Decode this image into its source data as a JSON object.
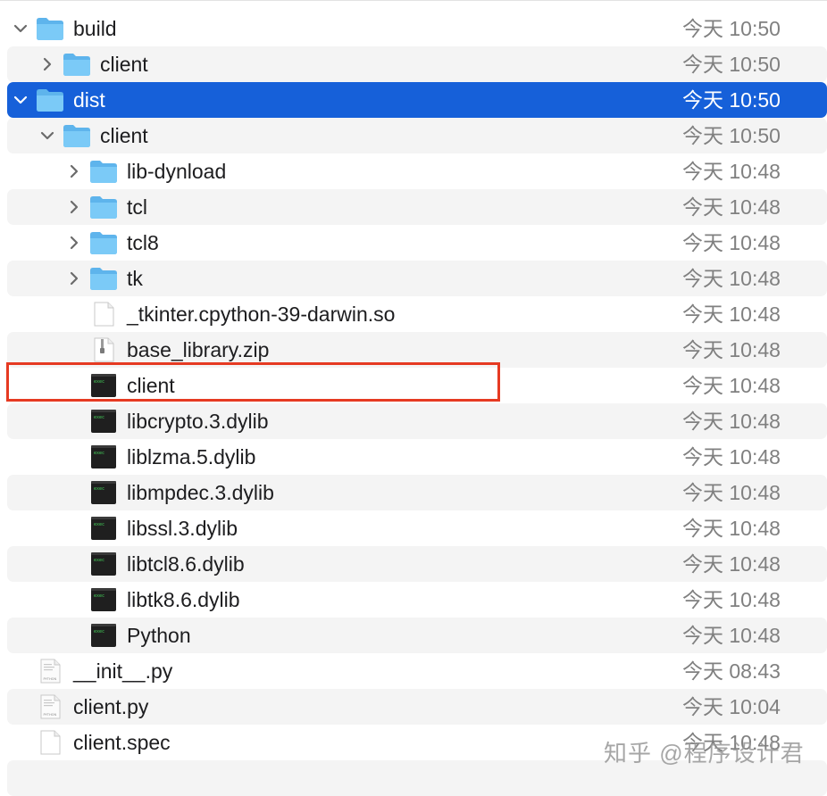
{
  "colors": {
    "selection": "#1660d9",
    "highlight_box": "#e63a22",
    "folder": "#6ec3f4",
    "alt_row": "#f4f4f4",
    "date_text": "#808080"
  },
  "rows": [
    {
      "name": "build",
      "date": "今天 10:50",
      "type": "folder",
      "expanded": true,
      "depth": 0
    },
    {
      "name": "client",
      "date": "今天 10:50",
      "type": "folder",
      "expanded": false,
      "depth": 1
    },
    {
      "name": "dist",
      "date": "今天 10:50",
      "type": "folder",
      "expanded": true,
      "depth": 0,
      "selected": true
    },
    {
      "name": "client",
      "date": "今天 10:50",
      "type": "folder",
      "expanded": true,
      "depth": 1
    },
    {
      "name": "lib-dynload",
      "date": "今天 10:48",
      "type": "folder",
      "expanded": false,
      "depth": 2
    },
    {
      "name": "tcl",
      "date": "今天 10:48",
      "type": "folder",
      "expanded": false,
      "depth": 2
    },
    {
      "name": "tcl8",
      "date": "今天 10:48",
      "type": "folder",
      "expanded": false,
      "depth": 2
    },
    {
      "name": "tk",
      "date": "今天 10:48",
      "type": "folder",
      "expanded": false,
      "depth": 2
    },
    {
      "name": "_tkinter.cpython-39-darwin.so",
      "date": "今天 10:48",
      "type": "file",
      "depth": 2
    },
    {
      "name": "base_library.zip",
      "date": "今天 10:48",
      "type": "zip",
      "depth": 2
    },
    {
      "name": "client",
      "date": "今天 10:48",
      "type": "exec",
      "depth": 2,
      "highlighted": true
    },
    {
      "name": "libcrypto.3.dylib",
      "date": "今天 10:48",
      "type": "exec",
      "depth": 2
    },
    {
      "name": "liblzma.5.dylib",
      "date": "今天 10:48",
      "type": "exec",
      "depth": 2
    },
    {
      "name": "libmpdec.3.dylib",
      "date": "今天 10:48",
      "type": "exec",
      "depth": 2
    },
    {
      "name": "libssl.3.dylib",
      "date": "今天 10:48",
      "type": "exec",
      "depth": 2
    },
    {
      "name": "libtcl8.6.dylib",
      "date": "今天 10:48",
      "type": "exec",
      "depth": 2
    },
    {
      "name": "libtk8.6.dylib",
      "date": "今天 10:48",
      "type": "exec",
      "depth": 2
    },
    {
      "name": "Python",
      "date": "今天 10:48",
      "type": "exec",
      "depth": 2
    },
    {
      "name": "__init__.py",
      "date": "今天 08:43",
      "type": "python",
      "depth": 0
    },
    {
      "name": "client.py",
      "date": "今天 10:04",
      "type": "python",
      "depth": 0
    },
    {
      "name": "client.spec",
      "date": "今天 10:48",
      "type": "file",
      "depth": 0
    }
  ],
  "watermark": "知乎 @程序设计君"
}
